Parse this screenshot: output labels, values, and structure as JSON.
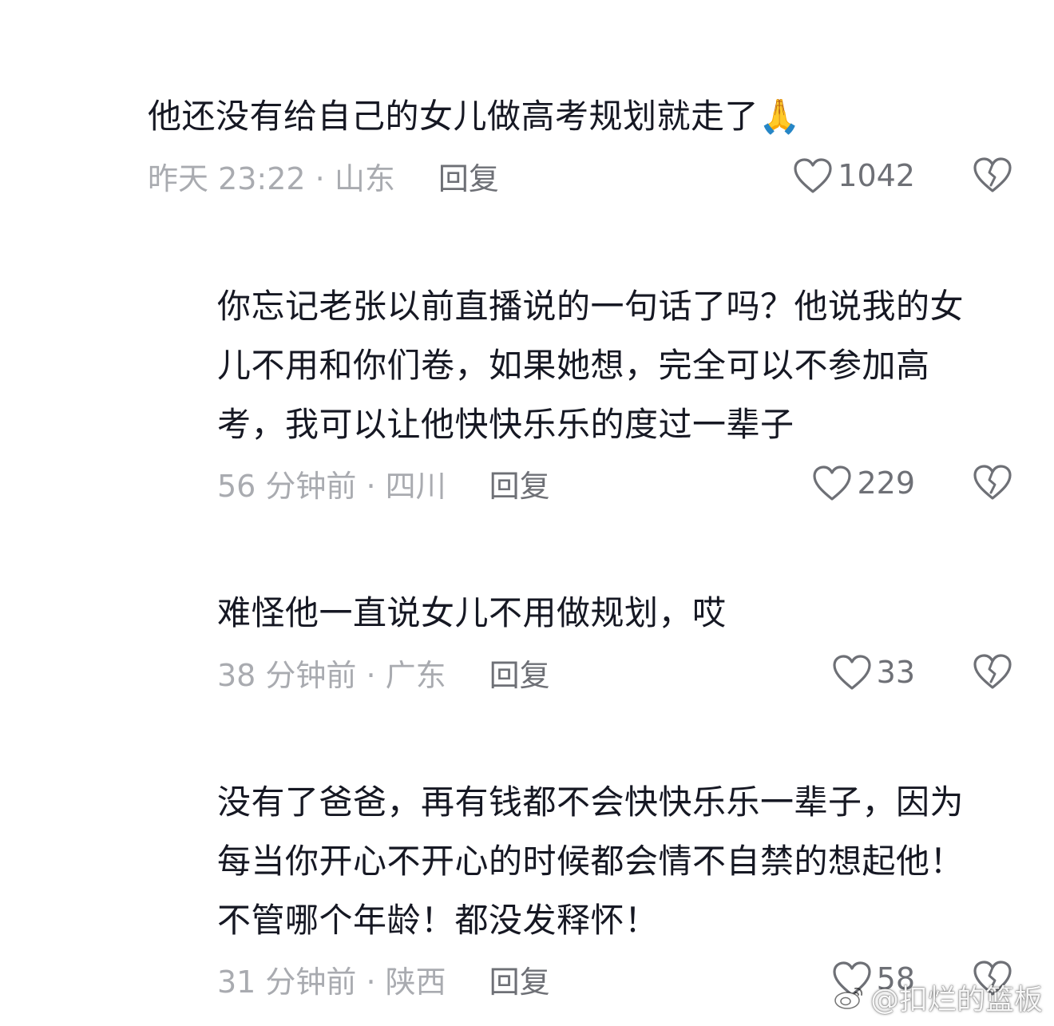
{
  "comments": [
    {
      "text": "他还没有给自己的女儿做高考规划就走了🙏",
      "meta": "昨天 23:22 · 山东",
      "reply_label": "回复",
      "likes": "1042"
    },
    {
      "text": "你忘记老张以前直播说的一句话了吗？他说我的女\n儿不用和你们卷，如果她想，完全可以不参加高\n考，我可以让他快快乐乐的度过一辈子",
      "meta": "56 分钟前 · 四川",
      "reply_label": "回复",
      "likes": "229"
    },
    {
      "text": "难怪他一直说女儿不用做规划，哎",
      "meta": "38 分钟前 · 广东",
      "reply_label": "回复",
      "likes": "33"
    },
    {
      "text": "没有了爸爸，再有钱都不会快快乐乐一辈子，因为\n每当你开心不开心的时候都会情不自禁的想起他！\n不管哪个年龄！都没发释怀！",
      "meta": "31 分钟前 · 陕西",
      "reply_label": "回复",
      "likes": "58"
    }
  ],
  "watermark": {
    "text": "@扣烂的篮板",
    "icon": "weibo-logo-icon"
  },
  "colors": {
    "text": "#161823",
    "meta": "#a9abb0",
    "action": "#6e7076"
  }
}
